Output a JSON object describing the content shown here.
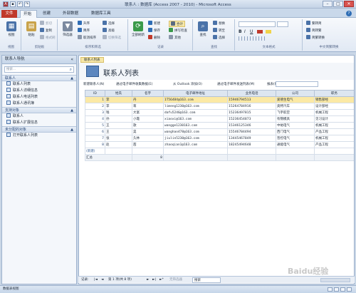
{
  "window": {
    "title": "联系人 : 数据库 (Access 2007 - 2010) - Microsoft Access",
    "title_display": "联系人 : 数据库 (Access 2007 - 2010) - Microsoft Access"
  },
  "ribbon_tabs": [
    "文件",
    "开始",
    "创建",
    "外部数据",
    "数据库工具"
  ],
  "ribbon": {
    "groups": [
      {
        "label": "视图"
      },
      {
        "label": "剪贴板"
      },
      {
        "label": "排序和筛选"
      },
      {
        "label": "记录"
      },
      {
        "label": "查找"
      },
      {
        "label": "文本格式"
      },
      {
        "label": "中文简繁转换"
      }
    ],
    "view": "视图",
    "paste": "粘贴",
    "cut": "剪切",
    "copy": "复制",
    "format_painter": "格式刷",
    "filter": "筛选器",
    "asc": "升序",
    "desc": "降序",
    "remove_sort": "取消排序",
    "selection": "选择",
    "advanced": "高级",
    "toggle_filter": "切换筛选",
    "refresh_all": "全部刷新",
    "new": "新建",
    "save": "保存",
    "delete": "删除",
    "totals": "合计",
    "spelling": "拼写检查",
    "more": "其他",
    "find": "查找",
    "replace": "替换",
    "goto": "转至",
    "select": "选择",
    "simp_trad": "繁转简",
    "trad_simp": "简转繁",
    "simp_trad_convert": "简繁转换"
  },
  "nav_pane": {
    "title": "联系人导航",
    "search_placeholder": "搜索...",
    "groups": [
      {
        "label": "联系人",
        "items": [
          "联系人列表",
          "联系人详细信息",
          "联系人电话列表",
          "联系人通讯簿"
        ]
      },
      {
        "label": "支持对象",
        "items": [
          "联系人",
          "联系人扩展信息"
        ]
      },
      {
        "label": "未分配的对象",
        "items": [
          "打开联系人列表"
        ]
      }
    ]
  },
  "document": {
    "tab_label": "联系人列表",
    "title": "联系人列表",
    "links": [
      "新建联系人(N)",
      "通过电子邮件收集数据(E)",
      "从 Outlook 添加(O)",
      "通过电子邮件发送列表(M)",
      "报表(R)"
    ]
  },
  "table": {
    "columns": [
      "ID",
      "姓氏",
      "名字",
      "电子邮件地址",
      "业务电话",
      "公司",
      "职务"
    ],
    "rows": [
      {
        "id": "1",
        "surname": "李",
        "given": "丹",
        "email": "1T56484@163.com",
        "phone": "15946794513",
        "company": "爱德生电气",
        "title": "销售部经"
      },
      {
        "id": "2",
        "surname": "李",
        "given": "蒋",
        "email": "limeng1230@163.com",
        "phone": "15264784916",
        "company": "奥特汽车",
        "title": "设计部经"
      },
      {
        "id": "3",
        "surname": "钱",
        "given": "大富",
        "email": "dafu5246@163.com",
        "phone": "15236497815",
        "company": "飞宇航空",
        "title": "机械工程"
      },
      {
        "id": "4",
        "surname": "孙",
        "given": "小霞",
        "email": "xiaoxi@163.com",
        "phone": "15236454873",
        "company": "有锦模具",
        "title": "见习设计"
      },
      {
        "id": "5",
        "surname": "王",
        "given": "歌",
        "email": "wangge1230163.com",
        "phone": "15346125346",
        "company": "中裕电气",
        "title": "机械工程"
      },
      {
        "id": "6",
        "surname": "王",
        "given": "昊",
        "email": "wanghao478@163.com",
        "phone": "15546784494",
        "company": "西门电气",
        "title": "产品工程"
      },
      {
        "id": "7",
        "surname": "张",
        "given": "久林",
        "email": "jiulin5230@163.com",
        "phone": "13445467849",
        "company": "晋控电气",
        "title": "机械工程"
      },
      {
        "id": "8",
        "surname": "赵",
        "given": "茜",
        "email": "zhaoqian1@163.com",
        "phone": "18245494648",
        "company": "通能电气",
        "title": "产品工程"
      }
    ],
    "new_label": "(新建)",
    "total_label": "汇总",
    "total_value": "8"
  },
  "record_nav": {
    "label": "记录:",
    "position": "第 1 项(共 8 项)",
    "filter": "无筛选器",
    "search": "搜索"
  },
  "status": {
    "text": "数据表视图"
  },
  "watermark": "Baidu经验"
}
